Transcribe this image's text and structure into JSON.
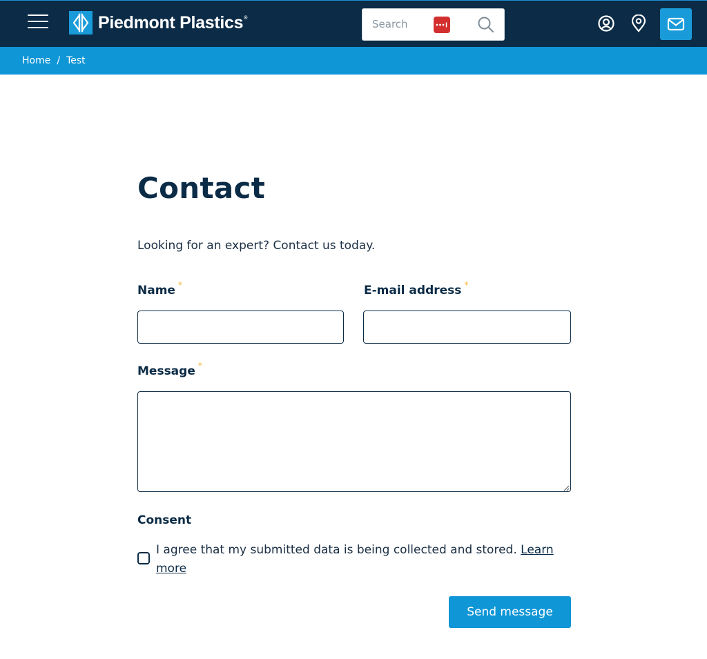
{
  "header": {
    "brand_name": "Piedmont Plastics",
    "brand_reg": "®",
    "search_placeholder": "Search",
    "icons": [
      "menu-icon",
      "logo-icon",
      "password-manager-icon",
      "search-icon",
      "account-icon",
      "location-icon",
      "mail-icon"
    ]
  },
  "breadcrumb": {
    "items": [
      "Home",
      "Test"
    ],
    "separator": "/"
  },
  "page": {
    "title": "Contact",
    "intro": "Looking for an expert? Contact us today."
  },
  "form": {
    "name_label": "Name",
    "email_label": "E-mail address",
    "message_label": "Message",
    "required_mark": "*",
    "name_value": "",
    "email_value": "",
    "message_value": "",
    "consent_heading": "Consent",
    "consent_text": "I agree that my submitted data is being collected and stored.",
    "consent_link": "Learn more",
    "consent_checked": false,
    "submit_label": "Send message"
  },
  "colors": {
    "navy": "#0b2b46",
    "accent_blue": "#0f96d6",
    "required_star": "#f2b636",
    "password_badge": "#d32f2f"
  }
}
